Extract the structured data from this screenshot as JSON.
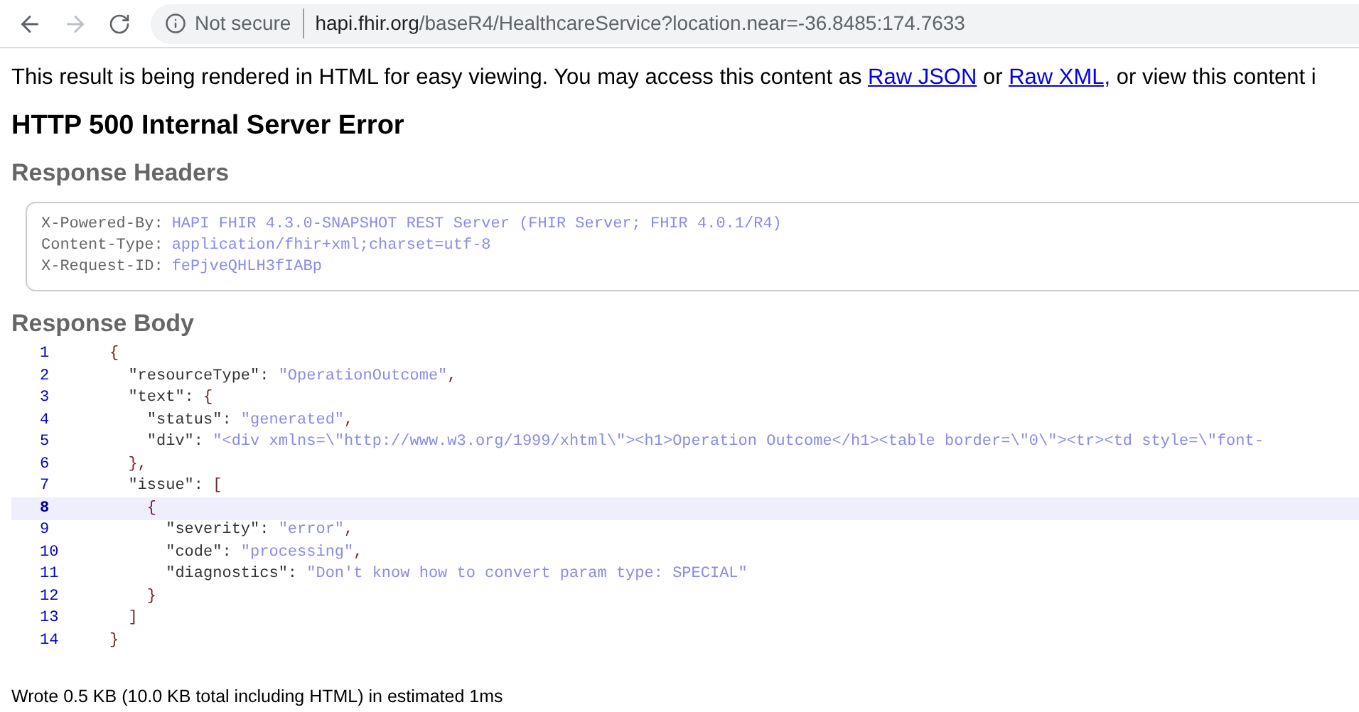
{
  "browser": {
    "security": "Not secure",
    "url_host": "hapi.fhir.org",
    "url_path": "/baseR4/HealthcareService?location.near=-36.8485:174.7633"
  },
  "intro": {
    "text": "This result is being rendered in HTML for easy viewing. You may access this content as ",
    "links": [
      "Raw JSON",
      "Raw XML,"
    ],
    "between": " or ",
    "after": " or view this content i"
  },
  "title": "HTTP 500 Internal Server Error",
  "headers_heading": "Response Headers",
  "headers": [
    {
      "name": "X-Powered-By:",
      "value": "HAPI FHIR 4.3.0-SNAPSHOT REST Server (FHIR Server; FHIR 4.0.1/R4)"
    },
    {
      "name": "Content-Type:",
      "value": "application/fhir+xml;charset=utf-8"
    },
    {
      "name": "X-Request-ID:",
      "value": "fePjveQHLH3fIABp"
    }
  ],
  "body_heading": "Response Body",
  "code_lines": [
    {
      "number": "1",
      "selected": false,
      "tokens": [
        {
          "kind": "punct",
          "text": "{"
        }
      ]
    },
    {
      "number": "2",
      "selected": false,
      "tokens": [
        {
          "kind": "key",
          "text": "  \"resourceType\": "
        },
        {
          "kind": "string",
          "text": "\"OperationOutcome\""
        },
        {
          "kind": "punct",
          "text": ","
        }
      ]
    },
    {
      "number": "3",
      "selected": false,
      "tokens": [
        {
          "kind": "key",
          "text": "  \"text\": "
        },
        {
          "kind": "punct",
          "text": "{"
        }
      ]
    },
    {
      "number": "4",
      "selected": false,
      "tokens": [
        {
          "kind": "key",
          "text": "    \"status\": "
        },
        {
          "kind": "string",
          "text": "\"generated\""
        },
        {
          "kind": "punct",
          "text": ","
        }
      ]
    },
    {
      "number": "5",
      "selected": false,
      "tokens": [
        {
          "kind": "key",
          "text": "    \"div\": "
        },
        {
          "kind": "string",
          "text": "\"<div xmlns=\\\"http://www.w3.org/1999/xhtml\\\"><h1>Operation Outcome</h1><table border=\\\"0\\\"><tr><td style=\\\"font-"
        }
      ]
    },
    {
      "number": "6",
      "selected": false,
      "tokens": [
        {
          "kind": "punct",
          "text": "  },"
        }
      ]
    },
    {
      "number": "7",
      "selected": false,
      "tokens": [
        {
          "kind": "key",
          "text": "  \"issue\": "
        },
        {
          "kind": "punct",
          "text": "["
        }
      ]
    },
    {
      "number": "8",
      "selected": true,
      "tokens": [
        {
          "kind": "punct",
          "text": "    {"
        }
      ]
    },
    {
      "number": "9",
      "selected": false,
      "tokens": [
        {
          "kind": "key",
          "text": "      \"severity\": "
        },
        {
          "kind": "string",
          "text": "\"error\""
        },
        {
          "kind": "punct",
          "text": ","
        }
      ]
    },
    {
      "number": "10",
      "selected": false,
      "tokens": [
        {
          "kind": "key",
          "text": "      \"code\": "
        },
        {
          "kind": "string",
          "text": "\"processing\""
        },
        {
          "kind": "punct",
          "text": ","
        }
      ]
    },
    {
      "number": "11",
      "selected": false,
      "tokens": [
        {
          "kind": "key",
          "text": "      \"diagnostics\": "
        },
        {
          "kind": "string",
          "text": "\"Don't know how to convert param type: SPECIAL\""
        }
      ]
    },
    {
      "number": "12",
      "selected": false,
      "tokens": [
        {
          "kind": "punct",
          "text": "    }"
        }
      ]
    },
    {
      "number": "13",
      "selected": false,
      "tokens": [
        {
          "kind": "punct",
          "text": "  ]"
        }
      ]
    },
    {
      "number": "14",
      "selected": false,
      "tokens": [
        {
          "kind": "punct",
          "text": "}"
        }
      ]
    }
  ],
  "footer": "Wrote 0.5 KB (10.0 KB total including HTML) in estimated 1ms"
}
